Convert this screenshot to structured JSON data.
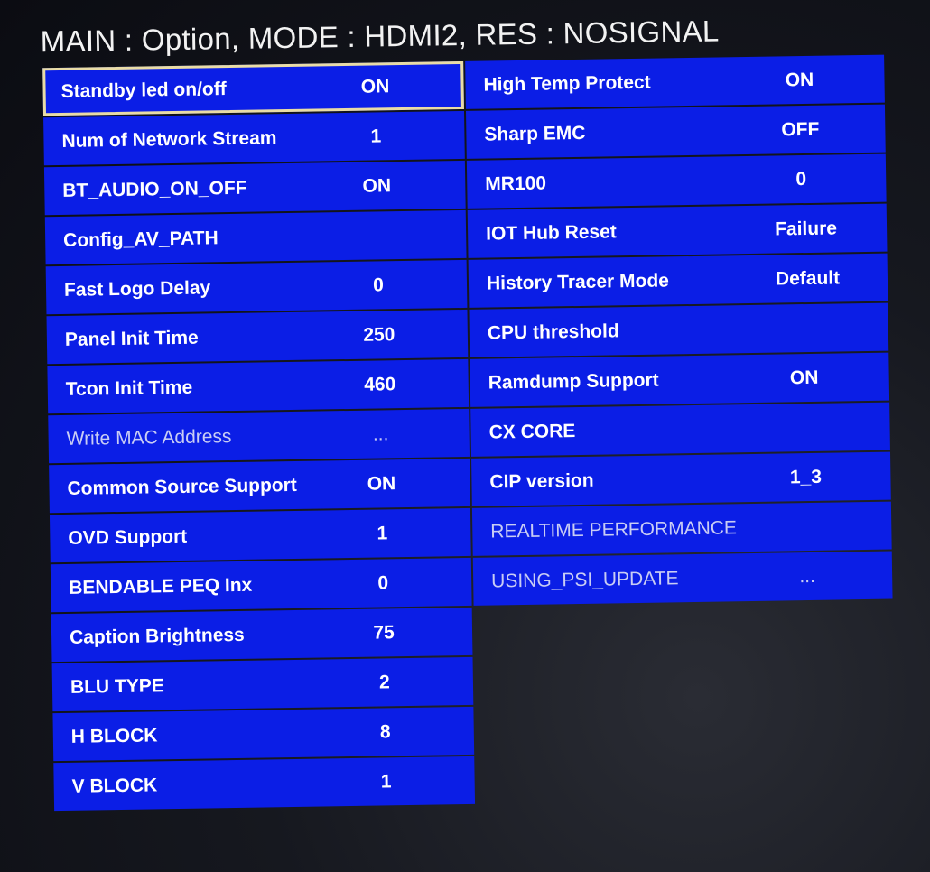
{
  "header": {
    "title": "MAIN : Option, MODE : HDMI2, RES : NOSIGNAL"
  },
  "left_items": [
    {
      "label": "Standby led on/off",
      "value": "ON",
      "selected": true
    },
    {
      "label": "Num of Network Stream",
      "value": "1"
    },
    {
      "label": "BT_AUDIO_ON_OFF",
      "value": "ON"
    },
    {
      "label": "Config_AV_PATH",
      "value": ""
    },
    {
      "label": "Fast Logo Delay",
      "value": "0"
    },
    {
      "label": "Panel Init Time",
      "value": "250"
    },
    {
      "label": "Tcon Init Time",
      "value": "460"
    },
    {
      "label": "Write MAC Address",
      "value": "...",
      "dim": true
    },
    {
      "label": "Common Source Support",
      "value": "ON"
    },
    {
      "label": "OVD Support",
      "value": "1"
    },
    {
      "label": "BENDABLE PEQ Inx",
      "value": "0"
    },
    {
      "label": "Caption Brightness",
      "value": "75"
    },
    {
      "label": "BLU TYPE",
      "value": "2"
    },
    {
      "label": "H BLOCK",
      "value": "8"
    },
    {
      "label": "V BLOCK",
      "value": "1"
    }
  ],
  "right_items": [
    {
      "label": "High Temp Protect",
      "value": "ON"
    },
    {
      "label": "Sharp EMC",
      "value": "OFF"
    },
    {
      "label": "MR100",
      "value": "0"
    },
    {
      "label": "IOT Hub Reset",
      "value": "Failure"
    },
    {
      "label": "History Tracer Mode",
      "value": "Default"
    },
    {
      "label": "CPU threshold",
      "value": ""
    },
    {
      "label": "Ramdump Support",
      "value": "ON"
    },
    {
      "label": "CX CORE",
      "value": ""
    },
    {
      "label": "CIP version",
      "value": "1_3"
    },
    {
      "label": "REALTIME PERFORMANCE",
      "value": "",
      "dim": true
    },
    {
      "label": "USING_PSI_UPDATE",
      "value": "...",
      "dim": true
    }
  ],
  "colors": {
    "row_bg": "#0b1ee6",
    "selection_border": "#e9dca6",
    "background": "#0d0f17"
  }
}
